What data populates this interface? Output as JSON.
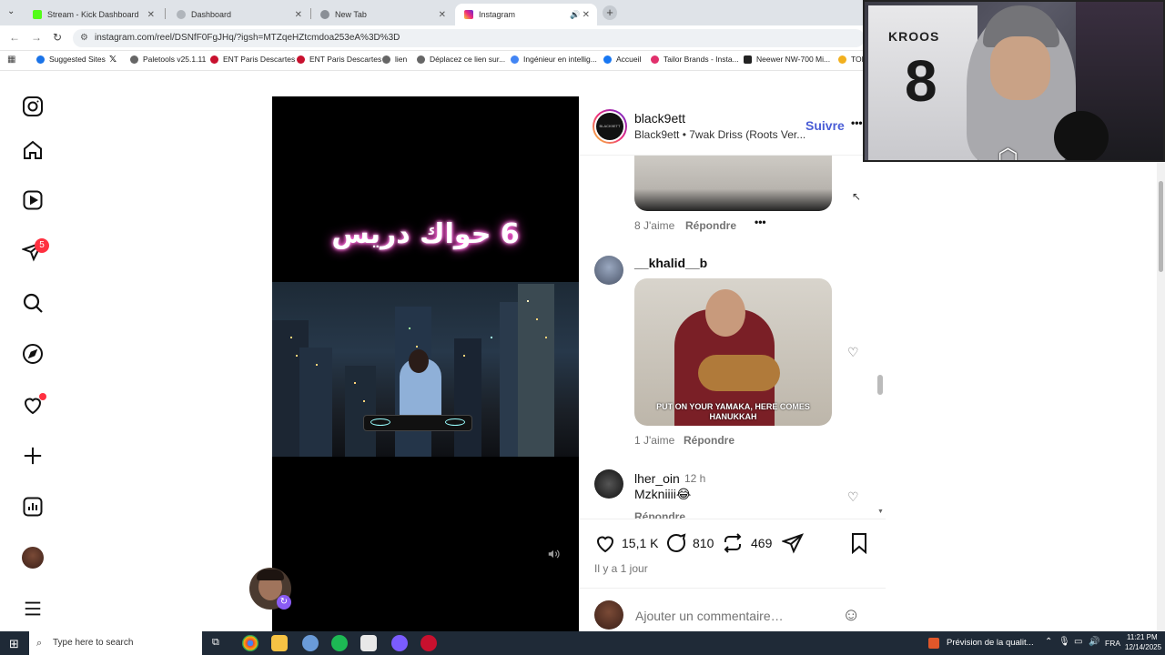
{
  "browser": {
    "tabs": [
      {
        "label": "Stream - Kick Dashboard",
        "color": "#53fc18"
      },
      {
        "label": "Dashboard",
        "color": "#9aa0a6"
      },
      {
        "label": "New Tab",
        "color": "#9aa0a6"
      },
      {
        "label": "Instagram",
        "color": "#e1306c"
      }
    ],
    "url": "instagram.com/reel/DSNfF0FgJHq/?igsh=MTZqeHZtcmdoa253eA%3D%3D",
    "bookmarks": [
      {
        "label": "Suggested Sites",
        "color": "#1a73e8"
      },
      {
        "label": "",
        "color": "#000000"
      },
      {
        "label": "Paletools v25.1.11",
        "color": "#555555"
      },
      {
        "label": "ENT Paris Descartes",
        "color": "#c8102e"
      },
      {
        "label": "ENT Paris Descartes",
        "color": "#c8102e"
      },
      {
        "label": "lien",
        "color": "#555555"
      },
      {
        "label": "Déplacez ce lien sur...",
        "color": "#555555"
      },
      {
        "label": "Ingénieur en intellig...",
        "color": "#4285f4"
      },
      {
        "label": "Accueil",
        "color": "#1877f2"
      },
      {
        "label": "Tailor Brands - Insta...",
        "color": "#e1306c"
      },
      {
        "label": "Neewer NW-700 Mi...",
        "color": "#222222"
      },
      {
        "label": "TON",
        "color": "#f2b01e"
      }
    ]
  },
  "nav": {
    "notifications_badge": "5"
  },
  "video": {
    "title": "6 حواك دريس"
  },
  "post": {
    "author": "black9ett",
    "author_avatar_text": "BLACK9ETT",
    "subtitle": "Black9ett • 7wak Driss (Roots Ver...",
    "follow_label": "Suivre",
    "more_label": "•••",
    "comments": [
      {
        "likes": "8 J'aime",
        "reply": "Répondre",
        "more": "•••"
      },
      {
        "user": "__khalid__b",
        "gif_caption": "PUT ON YOUR YAMAKA, HERE COMES HANUKKAH",
        "likes": "1 J'aime",
        "reply": "Répondre"
      },
      {
        "user": "lher_oin",
        "time": "12 h",
        "text": "Mzkniiii😂",
        "reply": "Répondre"
      }
    ],
    "like_count": "15,1 K",
    "comment_count": "810",
    "repost_count": "469",
    "posted": "Il y a 1 jour",
    "comment_placeholder": "Ajouter un commentaire…"
  },
  "webcam": {
    "jersey_name": "KROOS",
    "jersey_number": "8"
  },
  "taskbar": {
    "search_placeholder": "Type here to search",
    "weather": "Prévision de la qualit...",
    "lang": "FRA",
    "time": "11:21 PM",
    "date": "12/14/2025"
  }
}
